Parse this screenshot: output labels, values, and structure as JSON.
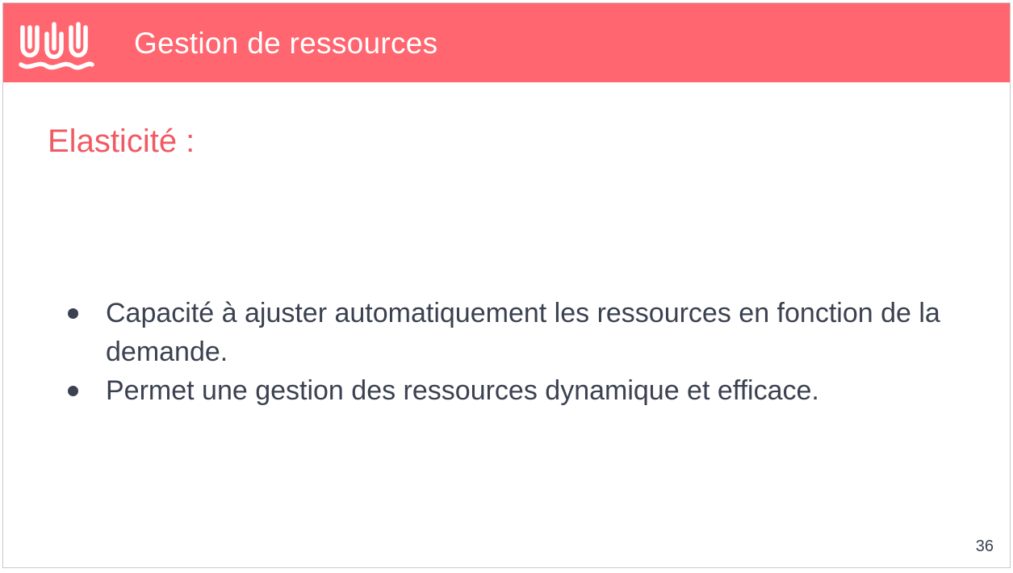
{
  "slide": {
    "header": {
      "title": "Gestion de ressources",
      "background_color": "#ff6670",
      "logo_icon": "wave-logo-icon"
    },
    "section_title": {
      "text": "Elasticité :",
      "color": "#f05a63"
    },
    "bullets": [
      "Capacité à ajuster automatiquement les ressources en fonction de la demande.",
      "Permet une gestion des ressources dynamique et efficace."
    ],
    "page_number": "36",
    "text_color": "#3a4150"
  }
}
